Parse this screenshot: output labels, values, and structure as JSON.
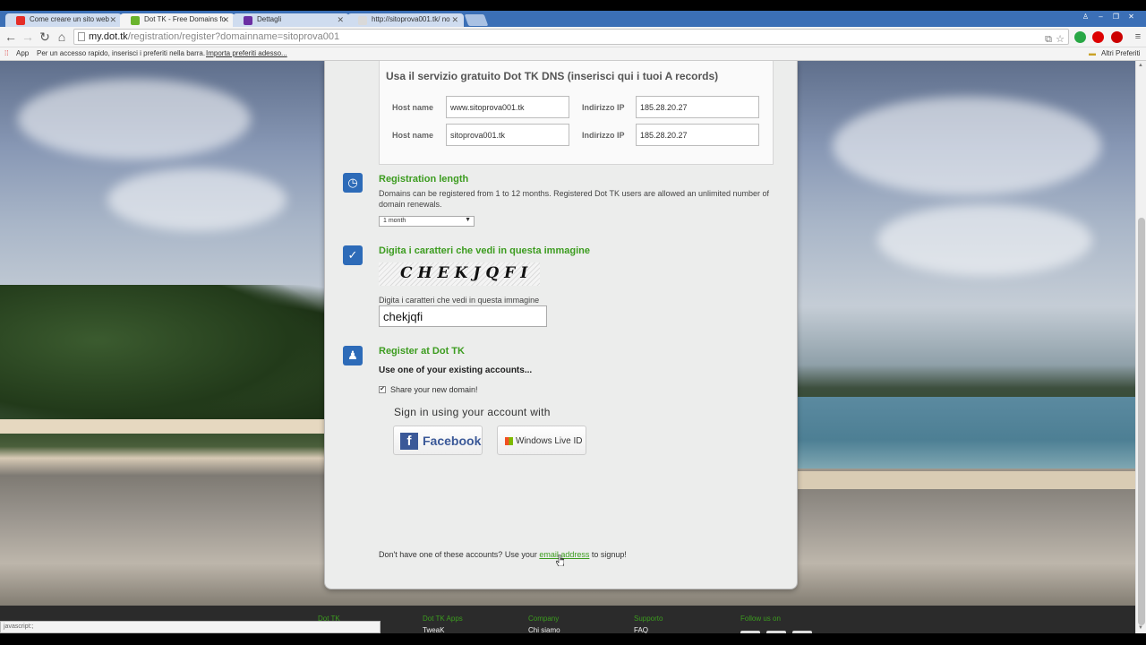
{
  "browser": {
    "tabs": [
      {
        "title": "Come creare un sito web",
        "favicon_color": "#e52d27"
      },
      {
        "title": "Dot TK - Free Domains fo",
        "favicon_color": "#6ab42d"
      },
      {
        "title": "Dettagli",
        "favicon_color": "#6b2fa3"
      },
      {
        "title": "http://sitoprova001.tk/ no",
        "favicon_color": "#d9d9d9"
      }
    ],
    "url_domain": "my.dot.tk",
    "url_path": "/registration/register?domainname=sitoprova001",
    "bookmarks_apps": "App",
    "bookmarks_hint": "Per un accesso rapido, inserisci i preferiti nella barra.",
    "bookmarks_import": "Importa preferiti adesso...",
    "bookmarks_other": "Altri Preferiti",
    "status_text": "javascript:;"
  },
  "dns": {
    "title": "Usa il servizio gratuito Dot TK DNS (inserisci qui i tuoi A records)",
    "host_label": "Host name",
    "ip_label": "Indirizzo IP",
    "rows": [
      {
        "host": "www.sitoprova001.tk",
        "ip": "185.28.20.27"
      },
      {
        "host": "sitoprova001.tk",
        "ip": "185.28.20.27"
      }
    ]
  },
  "registration": {
    "title": "Registration length",
    "description": "Domains can be registered from 1 to 12 months. Registered Dot TK users are allowed an unlimited number of domain renewals.",
    "selected": "1 month"
  },
  "captcha": {
    "title": "Digita i caratteri che vedi in questa immagine",
    "image_text": "CHEKJQFI",
    "field_label": "Digita i caratteri che vedi in questa immagine",
    "value": "chekjqfi"
  },
  "register": {
    "title": "Register at Dot TK",
    "subtitle": "Use one of your existing accounts...",
    "share_label": "Share your new domain!",
    "share_checked": true,
    "signin_text": "Sign in using your account with",
    "facebook_label": "Facebook",
    "windows_label": "Windows Live ID",
    "bottom_prefix": "Don't have one of these accounts? Use your",
    "bottom_link": "email address",
    "bottom_suffix": "to signup!"
  },
  "footer": {
    "columns": [
      {
        "title": "Dot TK",
        "link": ""
      },
      {
        "title": "Dot TK Apps",
        "link": "TweaK"
      },
      {
        "title": "Company",
        "link": "Chi siamo"
      },
      {
        "title": "Supporto",
        "link": "FAQ"
      },
      {
        "title": "Follow us on",
        "link": ""
      }
    ]
  }
}
